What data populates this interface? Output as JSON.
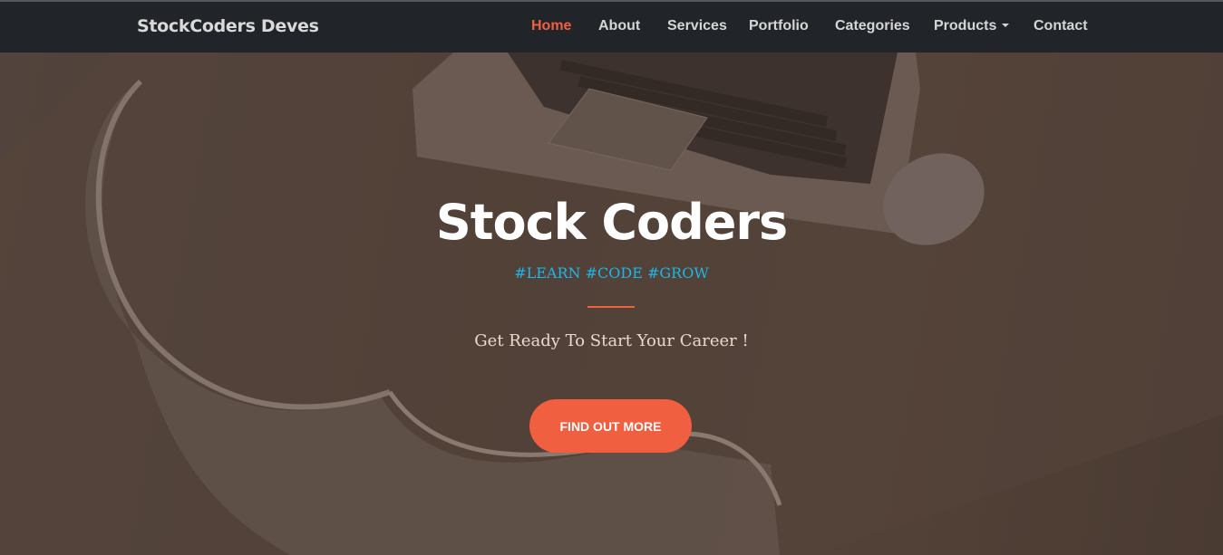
{
  "navbar": {
    "brand": "StockCoders Deves",
    "items": [
      {
        "label": "Home",
        "active": true
      },
      {
        "label": "About"
      },
      {
        "label": "Services"
      },
      {
        "label": "Portfolio"
      },
      {
        "label": "Categories"
      },
      {
        "label": "Products",
        "dropdown": true
      },
      {
        "label": "Contact"
      }
    ]
  },
  "hero": {
    "title": "Stock Coders",
    "tags": "#LEARN #CODE #GROW",
    "subtitle": "Get Ready To Start Your Career !",
    "cta_label": "FIND OUT MORE"
  },
  "colors": {
    "navbar_bg": "#212529",
    "accent": "#f05f40",
    "tag_color": "#1eb6e6"
  },
  "icons": {
    "products_dropdown": "caret-down-icon"
  }
}
